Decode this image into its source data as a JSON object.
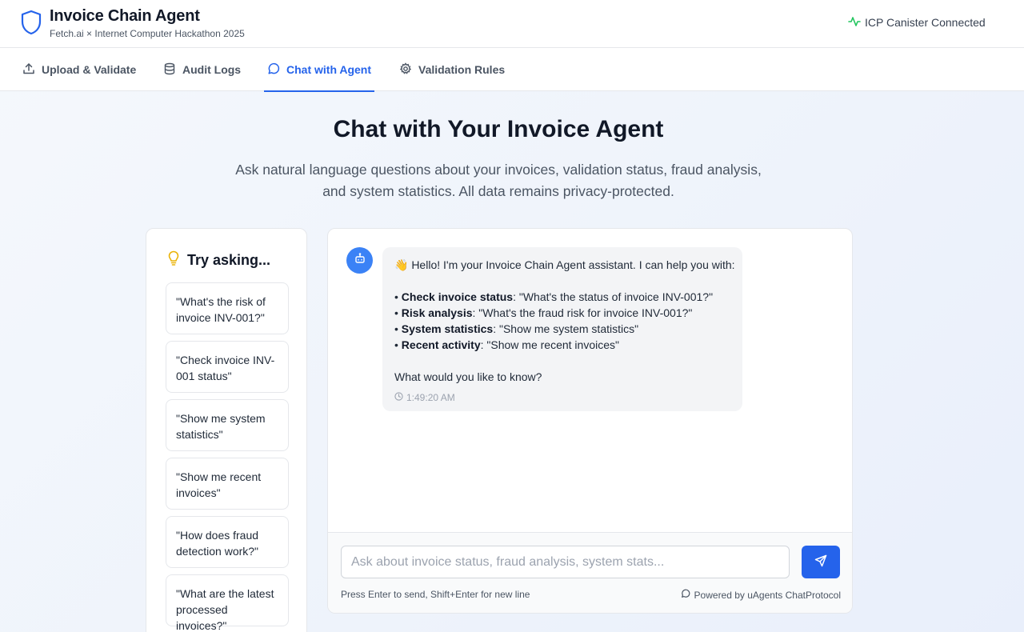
{
  "header": {
    "title": "Invoice Chain Agent",
    "subtitle": "Fetch.ai × Internet Computer Hackathon 2025",
    "logo_icon": "shield-icon",
    "status_icon": "activity-icon",
    "status_text": "ICP Canister Connected",
    "status_color": "#22c55e"
  },
  "tabs": [
    {
      "label": "Upload & Validate",
      "icon": "upload-icon",
      "active": false
    },
    {
      "label": "Audit Logs",
      "icon": "database-icon",
      "active": false
    },
    {
      "label": "Chat with Agent",
      "icon": "message-circle-icon",
      "active": true
    },
    {
      "label": "Validation Rules",
      "icon": "gear-icon",
      "active": false
    }
  ],
  "hero": {
    "title": "Chat with Your Invoice Agent",
    "description_line1": "Ask natural language questions about your invoices, validation status, fraud analysis,",
    "description_line2": "and system statistics. All data remains privacy-protected."
  },
  "suggestions": {
    "heading": "Try asking...",
    "heading_icon": "lightbulb-icon",
    "items": [
      {
        "line1": "\"What's the risk of",
        "line2": "invoice INV-001?\""
      },
      {
        "line1": "\"Check invoice INV-",
        "line2": "001 status\""
      },
      {
        "line1": "\"Show me system",
        "line2": "statistics\""
      },
      {
        "line1": "\"Show me recent",
        "line2": "invoices\""
      },
      {
        "line1": "\"How does fraud",
        "line2": "detection work?\""
      },
      {
        "line1": "\"What are the latest",
        "line2": "processed invoices?\""
      }
    ]
  },
  "chat": {
    "avatar_icon": "bot-icon",
    "message": {
      "greeting": "👋 Hello! I'm your Invoice Chain Agent assistant. I can help you with:",
      "bullets": [
        {
          "label": "Check invoice status",
          "text": ": \"What's the status of invoice INV-001?\""
        },
        {
          "label": "Risk analysis",
          "text": ": \"What's the fraud risk for invoice INV-001?\""
        },
        {
          "label": "System statistics",
          "text": ": \"Show me system statistics\""
        },
        {
          "label": "Recent activity",
          "text": ": \"Show me recent invoices\""
        }
      ],
      "closing": "What would you like to know?",
      "timestamp": "1:49:20 AM"
    },
    "input_placeholder": "Ask about invoice status, fraud analysis, system stats...",
    "input_value": "",
    "send_icon": "send-icon",
    "hint": "Press Enter to send, Shift+Enter for new line",
    "powered_by": "Powered by uAgents ChatProtocol"
  },
  "colors": {
    "accent": "#2563eb",
    "avatar": "#3b82f6",
    "lightbulb": "#eab308"
  }
}
